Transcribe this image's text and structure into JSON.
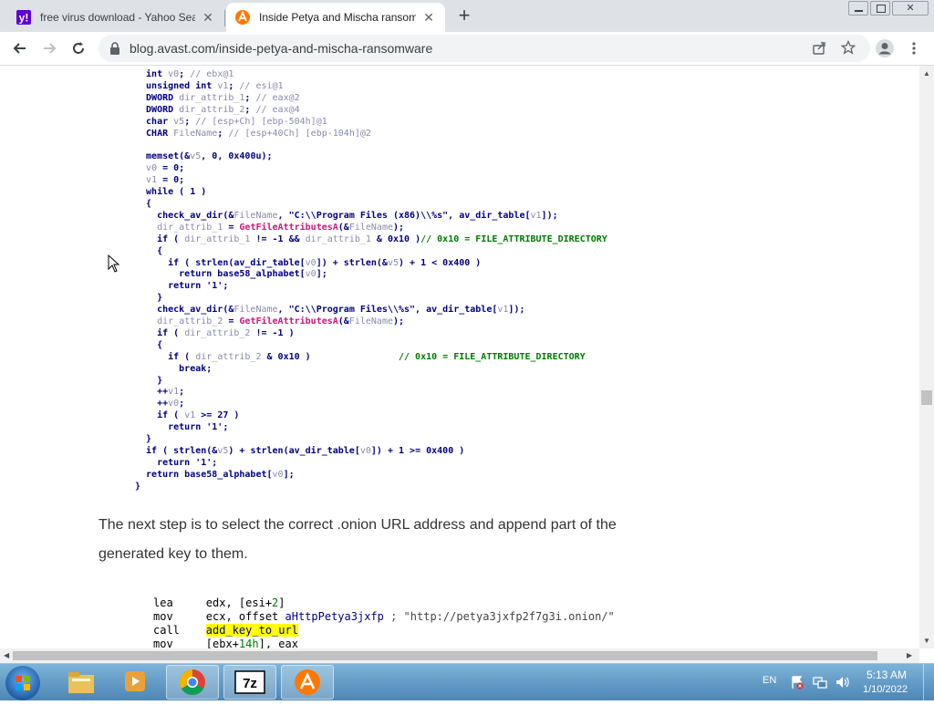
{
  "tabs": [
    {
      "title": "free virus download - Yahoo Search",
      "favicon": "yahoo-icon",
      "active": false
    },
    {
      "title": "Inside Petya and Mischa ransomware",
      "favicon": "avast-icon",
      "active": true
    }
  ],
  "toolbar": {
    "url": "blog.avast.com/inside-petya-and-mischa-ransomware"
  },
  "article": {
    "code_block_1": [
      "  int v0; // ebx@1",
      "  unsigned int v1; // esi@1",
      "  DWORD dir_attrib_1; // eax@2",
      "  DWORD dir_attrib_2; // eax@4",
      "  char v5; // [esp+Ch] [ebp-504h]@1",
      "  CHAR FileName; // [esp+40Ch] [ebp-104h]@2",
      "",
      "  memset(&v5, 0, 0x400u);",
      "  v0 = 0;",
      "  v1 = 0;",
      "  while ( 1 )",
      "  {",
      "    check_av_dir(&FileName, \"C:\\\\Program Files (x86)\\\\%s\", av_dir_table[v1]);",
      "    dir_attrib_1 = GetFileAttributesA(&FileName);",
      "    if ( dir_attrib_1 != -1 && dir_attrib_1 & 0x10 )// 0x10 = FILE_ATTRIBUTE_DIRECTORY",
      "    {",
      "      if ( strlen(av_dir_table[v0]) + strlen(&v5) + 1 < 0x400 )",
      "        return base58_alphabet[v0];",
      "      return '1';",
      "    }",
      "    check_av_dir(&FileName, \"C:\\\\Program Files\\\\%s\", av_dir_table[v1]);",
      "    dir_attrib_2 = GetFileAttributesA(&FileName);",
      "    if ( dir_attrib_2 != -1 )",
      "    {",
      "      if ( dir_attrib_2 & 0x10 )                // 0x10 = FILE_ATTRIBUTE_DIRECTORY",
      "        break;",
      "    }",
      "    ++v1;",
      "    ++v0;",
      "    if ( v1 >= 27 )",
      "      return '1';",
      "  }",
      "  if ( strlen(&v5) + strlen(av_dir_table[v0]) + 1 >= 0x400 )",
      "    return '1';",
      "  return base58_alphabet[v0];",
      "}"
    ],
    "paragraph": "The next step is to select the correct .onion URL address and append part of the generated key to them.",
    "code_block_2": [
      "lea     edx, [esi+2]",
      "mov     ecx, offset aHttpPetya3jxfp ; \"http://petya3jxfp2f7g3i.onion/\"",
      "call    add_key_to_url",
      "mov     [ebx+14h], eax"
    ]
  },
  "taskbar": {
    "language": "EN",
    "time": "5:13 AM",
    "date": "1/10/2022",
    "apps": [
      "start-orb",
      "file-explorer",
      "media-player",
      "chrome",
      "7-zip",
      "avast"
    ]
  },
  "colors": {
    "code_blue": "#000080",
    "code_gray": "#8a8aa8",
    "code_green": "#007a00",
    "code_pink": "#d0147c",
    "highlight": "#ffff00",
    "taskbar": "#4d86b5"
  }
}
